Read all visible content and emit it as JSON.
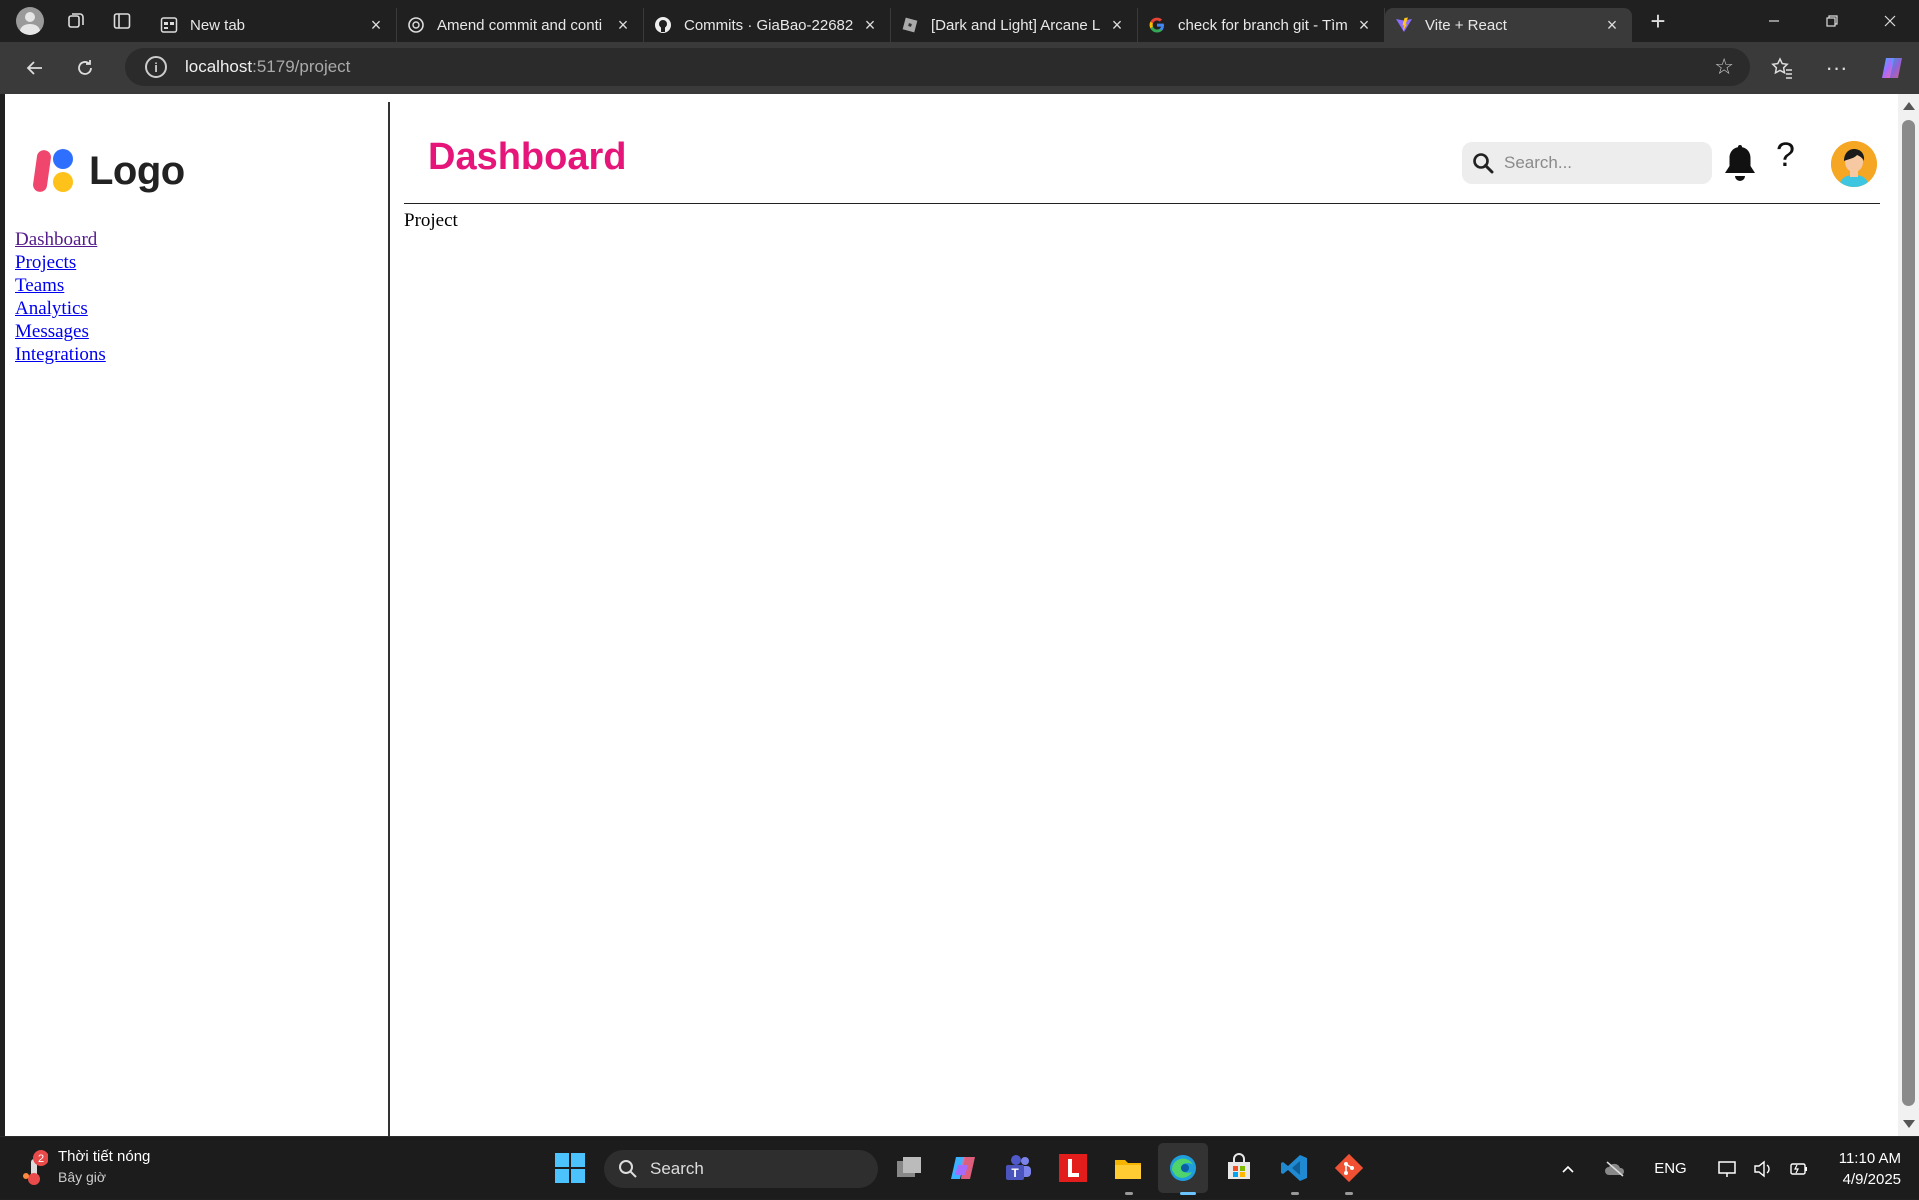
{
  "browser": {
    "tabs": [
      {
        "title": "New tab",
        "icon": "new-tab-icon",
        "active": false
      },
      {
        "title": "Amend commit and conti",
        "icon": "chatgpt-icon",
        "active": false
      },
      {
        "title": "Commits · GiaBao-22682",
        "icon": "github-icon",
        "active": false
      },
      {
        "title": "[Dark and Light] Arcane L",
        "icon": "roblox-icon",
        "active": false
      },
      {
        "title": "check for branch git - Tìm",
        "icon": "google-icon",
        "active": false
      },
      {
        "title": "Vite + React",
        "icon": "vite-icon",
        "active": true
      }
    ],
    "address": {
      "host": "localhost",
      "path": ":5179/project"
    }
  },
  "app": {
    "logo_text": "Logo",
    "nav": [
      {
        "label": "Dashboard",
        "visited": true
      },
      {
        "label": "Projects",
        "visited": false
      },
      {
        "label": "Teams",
        "visited": false
      },
      {
        "label": "Analytics",
        "visited": false
      },
      {
        "label": "Messages",
        "visited": false
      },
      {
        "label": "Integrations",
        "visited": false
      }
    ],
    "title": "Dashboard",
    "title_color": "#e6157a",
    "search_placeholder": "Search...",
    "help_label": "?",
    "content": "Project"
  },
  "taskbar": {
    "weather_title": "Thời tiết nóng",
    "weather_sub": "Bây giờ",
    "weather_badge": "2",
    "search_label": "Search",
    "language": "ENG",
    "time": "11:10 AM",
    "date": "4/9/2025"
  }
}
